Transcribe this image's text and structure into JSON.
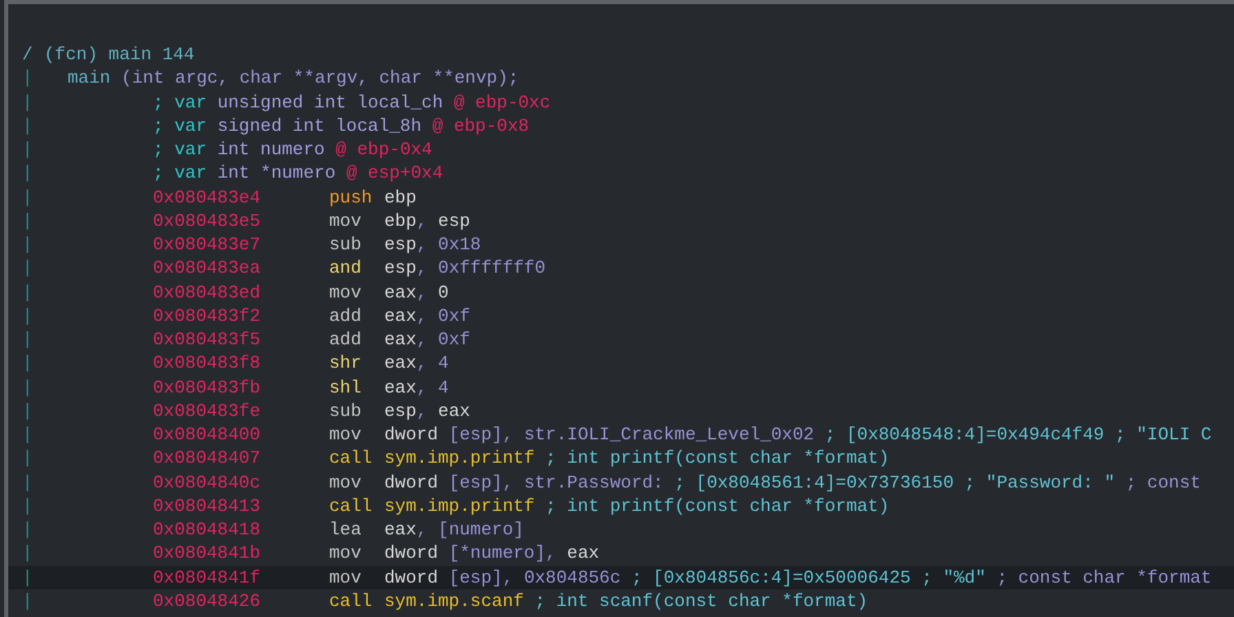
{
  "lines": [
    {
      "kind": "header",
      "gutter": "/",
      "text": "(fcn) main 144"
    },
    {
      "kind": "signature",
      "gutter": "|",
      "name": "main",
      "params": "(int argc, char **argv, char **envp);"
    },
    {
      "kind": "var",
      "gutter": "|",
      "prefix": "; var",
      "decl": "unsigned int local_ch",
      "location": "@ ebp-0xc"
    },
    {
      "kind": "var",
      "gutter": "|",
      "prefix": "; var",
      "decl": "signed int local_8h",
      "location": "@ ebp-0x8"
    },
    {
      "kind": "var",
      "gutter": "|",
      "prefix": "; var",
      "decl": "int numero",
      "location": "@ ebp-0x4"
    },
    {
      "kind": "var",
      "gutter": "|",
      "prefix": "; var",
      "decl": "int *numero",
      "location": "@ esp+0x4"
    },
    {
      "kind": "instr",
      "gutter": "|",
      "selected": false,
      "address": "0x080483e4",
      "mnemonic": {
        "kind": "stack",
        "text": "push"
      },
      "operands": [
        {
          "kind": "reg",
          "text": "ebp"
        }
      ]
    },
    {
      "kind": "instr",
      "gutter": "|",
      "selected": false,
      "address": "0x080483e5",
      "mnemonic": {
        "kind": "plain",
        "text": "mov"
      },
      "operands": [
        {
          "kind": "reg",
          "text": "ebp"
        },
        {
          "kind": "punct",
          "text": ", "
        },
        {
          "kind": "reg",
          "text": "esp"
        }
      ]
    },
    {
      "kind": "instr",
      "gutter": "|",
      "selected": false,
      "address": "0x080483e7",
      "mnemonic": {
        "kind": "plain",
        "text": "sub"
      },
      "operands": [
        {
          "kind": "reg",
          "text": "esp"
        },
        {
          "kind": "punct",
          "text": ", "
        },
        {
          "kind": "num",
          "text": "0x18"
        }
      ]
    },
    {
      "kind": "instr",
      "gutter": "|",
      "selected": false,
      "address": "0x080483ea",
      "mnemonic": {
        "kind": "bitwise",
        "text": "and"
      },
      "operands": [
        {
          "kind": "reg",
          "text": "esp"
        },
        {
          "kind": "punct",
          "text": ", "
        },
        {
          "kind": "num",
          "text": "0xfffffff0"
        }
      ]
    },
    {
      "kind": "instr",
      "gutter": "|",
      "selected": false,
      "address": "0x080483ed",
      "mnemonic": {
        "kind": "plain",
        "text": "mov"
      },
      "operands": [
        {
          "kind": "reg",
          "text": "eax"
        },
        {
          "kind": "punct",
          "text": ", "
        },
        {
          "kind": "reg",
          "text": "0"
        }
      ]
    },
    {
      "kind": "instr",
      "gutter": "|",
      "selected": false,
      "address": "0x080483f2",
      "mnemonic": {
        "kind": "plain",
        "text": "add"
      },
      "operands": [
        {
          "kind": "reg",
          "text": "eax"
        },
        {
          "kind": "punct",
          "text": ", "
        },
        {
          "kind": "num",
          "text": "0xf"
        }
      ]
    },
    {
      "kind": "instr",
      "gutter": "|",
      "selected": false,
      "address": "0x080483f5",
      "mnemonic": {
        "kind": "plain",
        "text": "add"
      },
      "operands": [
        {
          "kind": "reg",
          "text": "eax"
        },
        {
          "kind": "punct",
          "text": ", "
        },
        {
          "kind": "num",
          "text": "0xf"
        }
      ]
    },
    {
      "kind": "instr",
      "gutter": "|",
      "selected": false,
      "address": "0x080483f8",
      "mnemonic": {
        "kind": "bitwise",
        "text": "shr"
      },
      "operands": [
        {
          "kind": "reg",
          "text": "eax"
        },
        {
          "kind": "punct",
          "text": ", "
        },
        {
          "kind": "num",
          "text": "4"
        }
      ]
    },
    {
      "kind": "instr",
      "gutter": "|",
      "selected": false,
      "address": "0x080483fb",
      "mnemonic": {
        "kind": "bitwise",
        "text": "shl"
      },
      "operands": [
        {
          "kind": "reg",
          "text": "eax"
        },
        {
          "kind": "punct",
          "text": ", "
        },
        {
          "kind": "num",
          "text": "4"
        }
      ]
    },
    {
      "kind": "instr",
      "gutter": "|",
      "selected": false,
      "address": "0x080483fe",
      "mnemonic": {
        "kind": "plain",
        "text": "sub"
      },
      "operands": [
        {
          "kind": "reg",
          "text": "esp"
        },
        {
          "kind": "punct",
          "text": ", "
        },
        {
          "kind": "reg",
          "text": "eax"
        }
      ]
    },
    {
      "kind": "instr",
      "gutter": "|",
      "selected": false,
      "address": "0x08048400",
      "mnemonic": {
        "kind": "plain",
        "text": "mov"
      },
      "operands": [
        {
          "kind": "reg",
          "text": "dword "
        },
        {
          "kind": "num",
          "text": "[esp]"
        },
        {
          "kind": "punct",
          "text": ", "
        },
        {
          "kind": "num",
          "text": "str.IOLI_Crackme_Level_0x02"
        },
        {
          "kind": "comment",
          "text": " ; [0x8048548:4]=0x494c4f49 ; \"IOLI C"
        }
      ]
    },
    {
      "kind": "instr",
      "gutter": "|",
      "selected": false,
      "address": "0x08048407",
      "mnemonic": {
        "kind": "call",
        "text": "call"
      },
      "operands": [
        {
          "kind": "sym",
          "text": "sym.imp.printf"
        },
        {
          "kind": "comment",
          "text": " ; int printf(const char *format)"
        }
      ]
    },
    {
      "kind": "instr",
      "gutter": "|",
      "selected": false,
      "address": "0x0804840c",
      "mnemonic": {
        "kind": "plain",
        "text": "mov"
      },
      "operands": [
        {
          "kind": "reg",
          "text": "dword "
        },
        {
          "kind": "num",
          "text": "[esp]"
        },
        {
          "kind": "punct",
          "text": ", "
        },
        {
          "kind": "num",
          "text": "str.Password:"
        },
        {
          "kind": "comment",
          "text": " ; [0x8048561:4]=0x73736150 ; \"Password: \""
        },
        {
          "kind": "num",
          "text": " ; const"
        }
      ]
    },
    {
      "kind": "instr",
      "gutter": "|",
      "selected": false,
      "address": "0x08048413",
      "mnemonic": {
        "kind": "call",
        "text": "call"
      },
      "operands": [
        {
          "kind": "sym",
          "text": "sym.imp.printf"
        },
        {
          "kind": "comment",
          "text": " ; int printf(const char *format)"
        }
      ]
    },
    {
      "kind": "instr",
      "gutter": "|",
      "selected": false,
      "address": "0x08048418",
      "mnemonic": {
        "kind": "plain",
        "text": "lea"
      },
      "operands": [
        {
          "kind": "reg",
          "text": "eax"
        },
        {
          "kind": "punct",
          "text": ", "
        },
        {
          "kind": "num",
          "text": "[numero]"
        }
      ]
    },
    {
      "kind": "instr",
      "gutter": "|",
      "selected": false,
      "address": "0x0804841b",
      "mnemonic": {
        "kind": "plain",
        "text": "mov"
      },
      "operands": [
        {
          "kind": "reg",
          "text": "dword "
        },
        {
          "kind": "num",
          "text": "[*numero]"
        },
        {
          "kind": "punct",
          "text": ", "
        },
        {
          "kind": "reg",
          "text": "eax"
        }
      ]
    },
    {
      "kind": "instr",
      "gutter": "|",
      "selected": true,
      "address": "0x0804841f",
      "mnemonic": {
        "kind": "plain",
        "text": "mov"
      },
      "operands": [
        {
          "kind": "reg",
          "text": "dword "
        },
        {
          "kind": "num",
          "text": "[esp]"
        },
        {
          "kind": "punct",
          "text": ", "
        },
        {
          "kind": "num",
          "text": "0x804856c"
        },
        {
          "kind": "comment",
          "text": " ; [0x804856c:4]=0x50006425 ; \"%d\""
        },
        {
          "kind": "num",
          "text": " ; const char *format"
        }
      ]
    },
    {
      "kind": "instr",
      "gutter": "|",
      "selected": false,
      "address": "0x08048426",
      "mnemonic": {
        "kind": "call",
        "text": "call"
      },
      "operands": [
        {
          "kind": "sym",
          "text": "sym.imp.scanf"
        },
        {
          "kind": "comment",
          "text": " ; int scanf(const char *format)"
        }
      ]
    }
  ]
}
